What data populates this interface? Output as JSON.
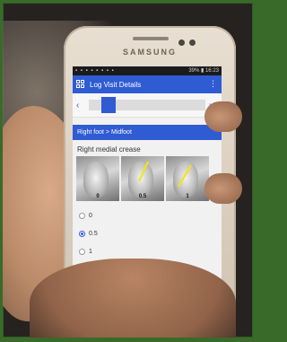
{
  "phone": {
    "brand": "SAMSUNG"
  },
  "status": {
    "left": "▪ ▪ ▪ ▪ ▪ ▪ ▪ ▪",
    "right": "39% ▮ 16:23"
  },
  "appbar": {
    "title": "Log Visit Details",
    "menu": "⋮"
  },
  "pager": {
    "prev": "‹",
    "next": "›"
  },
  "breadcrumb": "Right foot > Midfoot",
  "section_title": "Right medial crease",
  "images": [
    {
      "label": "0"
    },
    {
      "label": "0.5"
    },
    {
      "label": "1"
    }
  ],
  "options": [
    {
      "label": "0",
      "selected": false
    },
    {
      "label": "0.5",
      "selected": true
    },
    {
      "label": "1",
      "selected": false
    }
  ],
  "colors": {
    "accent": "#2f5bd3",
    "annotation": "#f3e700"
  }
}
